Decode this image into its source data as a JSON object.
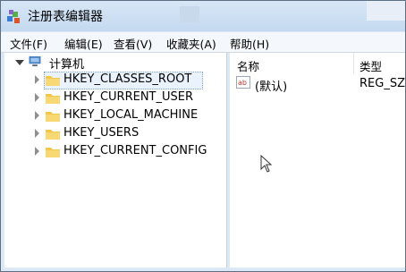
{
  "window": {
    "title": "注册表编辑器",
    "icon": "regedit-icon"
  },
  "menu": [
    {
      "label": "文件(F)"
    },
    {
      "label": "编辑(E)"
    },
    {
      "label": "查看(V)"
    },
    {
      "label": "收藏夹(A)"
    },
    {
      "label": "帮助(H)"
    }
  ],
  "tree": {
    "root": {
      "label": "计算机",
      "icon": "computer-icon",
      "expanded": true
    },
    "items": [
      {
        "label": "HKEY_CLASSES_ROOT",
        "selected": true
      },
      {
        "label": "HKEY_CURRENT_USER"
      },
      {
        "label": "HKEY_LOCAL_MACHINE"
      },
      {
        "label": "HKEY_USERS"
      },
      {
        "label": "HKEY_CURRENT_CONFIG"
      }
    ]
  },
  "values_pane": {
    "columns": [
      "名称",
      "类型"
    ],
    "rows": [
      {
        "name": "(默认)",
        "type": "REG_SZ",
        "icon": "string-value-icon"
      }
    ]
  },
  "colors": {
    "title_bar": "#c4d9ef",
    "folder": "#f2c84b",
    "selection": "#eaf2fd"
  }
}
